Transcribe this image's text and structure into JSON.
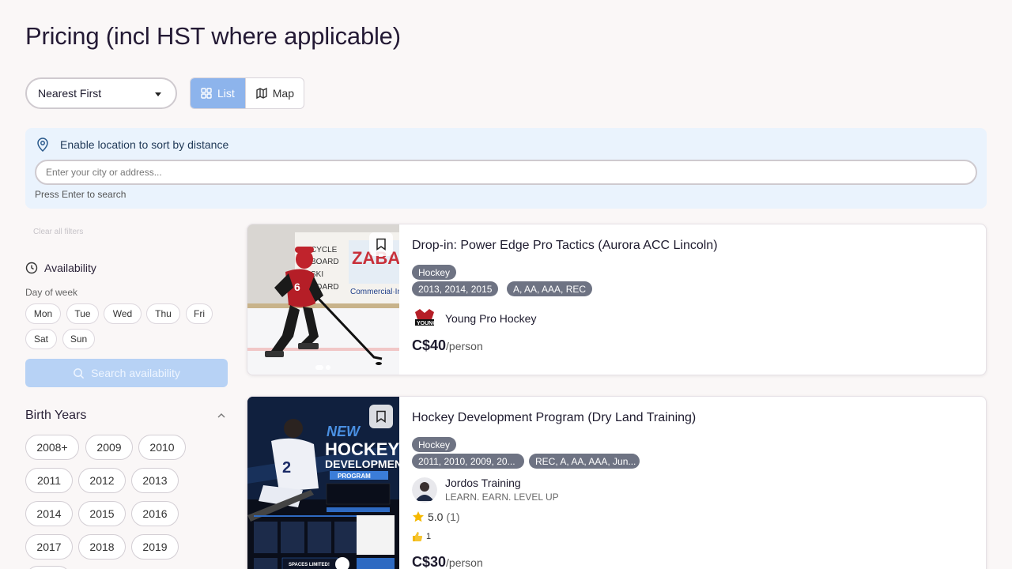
{
  "page": {
    "title": "Pricing (incl HST where applicable)"
  },
  "toolbar": {
    "sort_value": "Nearest First",
    "list_label": "List",
    "map_label": "Map"
  },
  "location": {
    "heading": "Enable location to sort by distance",
    "placeholder": "Enter your city or address...",
    "hint": "Press Enter to search"
  },
  "filters": {
    "clear_label": "Clear all filters",
    "availability_label": "Availability",
    "day_of_week_label": "Day of week",
    "days": [
      "Mon",
      "Tue",
      "Wed",
      "Thu",
      "Fri",
      "Sat",
      "Sun"
    ],
    "search_button": "Search availability",
    "birth_years_label": "Birth Years",
    "years": [
      "2008+",
      "2009",
      "2010",
      "2011",
      "2012",
      "2013",
      "2014",
      "2015",
      "2016",
      "2017",
      "2018",
      "2019"
    ]
  },
  "listings": [
    {
      "title": "Drop-in: Power Edge Pro Tactics (Aurora ACC Lincoln)",
      "sport": "Hockey",
      "years": "2013, 2014, 2015",
      "levels": "A, AA, AAA, REC",
      "org_name": "Young Pro Hockey",
      "price": "C$40",
      "price_unit": "/person"
    },
    {
      "title": "Hockey Development Program (Dry Land Training)",
      "sport": "Hockey",
      "years": "2011, 2010, 2009, 20...",
      "levels": "REC, A, AA, AAA, Jun...",
      "org_name": "Jordos Training",
      "org_tagline": "LEARN. EARN. LEVEL UP",
      "rating": "5.0",
      "rating_count": "(1)",
      "likes": "1",
      "price": "C$30",
      "price_unit": "/person",
      "poster": {
        "line1": "NEW",
        "line2": "HOCKEY",
        "line3": "DEVELOPMENT",
        "line4": "PROGRAM",
        "footer": "SPACES LIMITED!"
      }
    }
  ],
  "colors": {
    "accent": "#8db4ec",
    "tag_bg": "#6e7383",
    "panel_bg": "#eaf3fd"
  }
}
